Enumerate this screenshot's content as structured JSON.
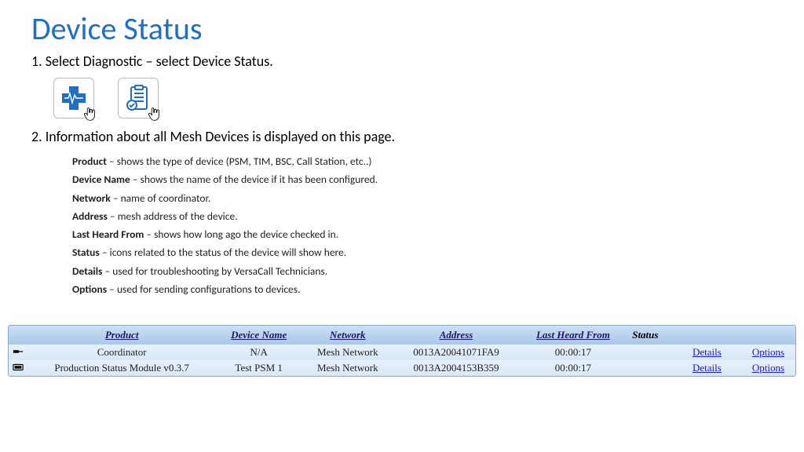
{
  "title": "Device Status",
  "step1": "1. Select Diagnostic – select Device Status.",
  "step2": "2. Information about all Mesh Devices is displayed on this page.",
  "defs": [
    {
      "term": "Product",
      "desc": " – shows the type of device (PSM, TIM, BSC, Call Station, etc..)"
    },
    {
      "term": "Device Name",
      "desc": " – shows the name of the device if it has been configured."
    },
    {
      "term": "Network",
      "desc": " – name of coordinator."
    },
    {
      "term": "Address",
      "desc": " – mesh address of the device."
    },
    {
      "term": "Last Heard From",
      "desc": " – shows how long ago the device checked in."
    },
    {
      "term": "Status",
      "desc": " – icons related to the status of the device will show here."
    },
    {
      "term": "Details",
      "desc": " – used for troubleshooting by VersaCall Technicians."
    },
    {
      "term": "Options",
      "desc": " – used for sending configurations to devices."
    }
  ],
  "table": {
    "headers": {
      "product": "Product",
      "device_name": "Device Name",
      "network": "Network",
      "address": "Address",
      "last_heard": "Last Heard From",
      "status": "Status"
    },
    "links": {
      "details": "Details",
      "options": "Options"
    },
    "rows": [
      {
        "icon": "connector",
        "product": "Coordinator",
        "device_name": "N/A",
        "network": "Mesh Network",
        "address": "0013A20041071FA9",
        "last_heard": "00:00:17"
      },
      {
        "icon": "module",
        "product": "Production Status Module v0.3.7",
        "device_name": "Test PSM 1",
        "network": "Mesh Network",
        "address": "0013A2004153B359",
        "last_heard": "00:00:17"
      }
    ]
  }
}
